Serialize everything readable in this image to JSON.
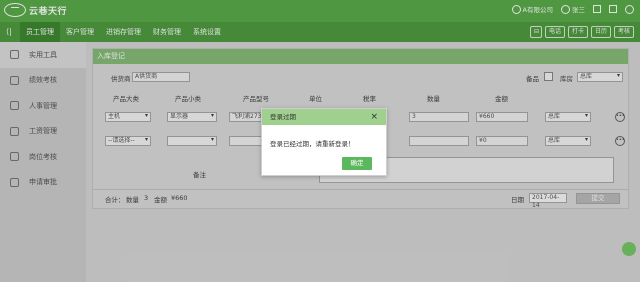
{
  "header": {
    "logo_text": "云巷天行",
    "company": "A有限公司",
    "user": "张三"
  },
  "nav": {
    "items": [
      "员工管理",
      "客户管理",
      "进销存管理",
      "财务管理",
      "系统设置"
    ],
    "right_buttons": [
      "电话",
      "打卡",
      "日历",
      "考核"
    ]
  },
  "sidebar": {
    "items": [
      "实用工具",
      "绩效考核",
      "人事管理",
      "工资管理",
      "岗位考核",
      "申请审批"
    ]
  },
  "panel": {
    "title": "入库登记",
    "supplier_label": "供货商",
    "supplier_value": "A供货商",
    "spare_label": "备品",
    "warehouse_label": "库房",
    "warehouse_value": "总库",
    "columns": [
      "产品大类",
      "产品小类",
      "产品型号",
      "单位",
      "税率",
      "数量",
      "金额"
    ],
    "rows": [
      {
        "category": "主机",
        "subcategory": "显示器",
        "model": "飞利浦273",
        "quantity": "3",
        "amount": "¥660",
        "warehouse": "总库"
      },
      {
        "category": "--请选择--",
        "subcategory": "",
        "model": "",
        "quantity": "",
        "amount": "¥0",
        "warehouse": "总库"
      }
    ],
    "remark_label": "备注",
    "total_label": "合计：",
    "count_label": "数量",
    "count_value": "3",
    "sum_label": "金额",
    "sum_value": "¥660",
    "date_label": "日期",
    "date_value": "2017-04-14",
    "submit_label": "提交"
  },
  "modal": {
    "title": "登录过期",
    "message": "登录已经过期，请重新登录！",
    "ok_label": "确定"
  },
  "colors": {
    "brand": "#5aae4a",
    "panel_header": "#88be7a",
    "modal_header": "#9fd08e",
    "ok_button": "#5cb85c"
  }
}
